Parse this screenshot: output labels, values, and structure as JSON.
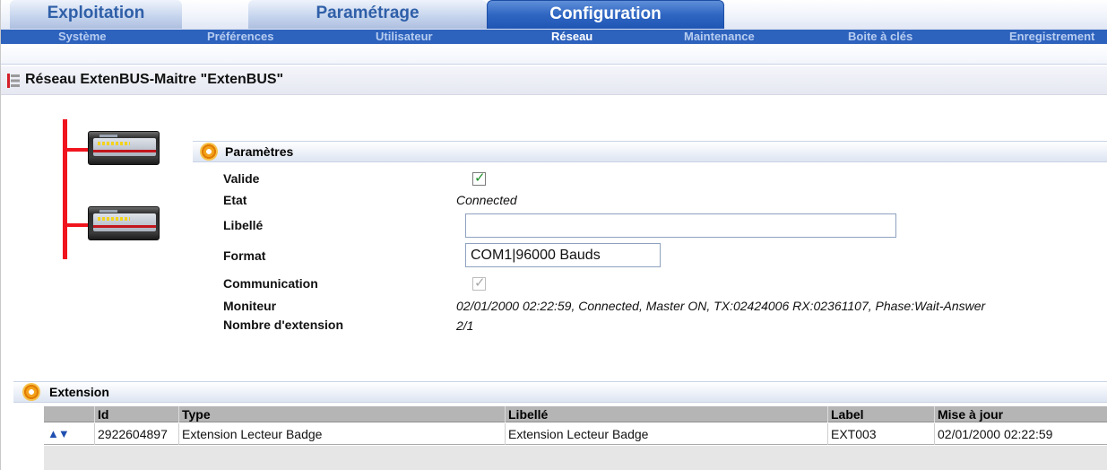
{
  "tabs": [
    {
      "label": "Exploitation",
      "active": false
    },
    {
      "label": "Paramétrage",
      "active": false
    },
    {
      "label": "Configuration",
      "active": true
    }
  ],
  "subnav": [
    {
      "label": "Système",
      "active": false
    },
    {
      "label": "Préférences",
      "active": false
    },
    {
      "label": "Utilisateur",
      "active": false
    },
    {
      "label": "Réseau",
      "active": true
    },
    {
      "label": "Maintenance",
      "active": false
    },
    {
      "label": "Boite à clés",
      "active": false
    },
    {
      "label": "Enregistrement",
      "active": false
    }
  ],
  "page": {
    "title": "Réseau ExtenBUS-Maitre \"ExtenBUS\"",
    "title_icon": "network-tree-icon"
  },
  "params": {
    "section_title": "Paramètres",
    "valide_label": "Valide",
    "valide_checked": true,
    "etat_label": "Etat",
    "etat_value": "Connected",
    "libelle_label": "Libellé",
    "libelle_value": "",
    "format_label": "Format",
    "format_value": "COM1|96000 Bauds",
    "communication_label": "Communication",
    "communication_checked": true,
    "moniteur_label": "Moniteur",
    "moniteur_value": "02/01/2000 02:22:59, Connected, Master ON,  TX:02424006 RX:02361107, Phase:Wait-Answer",
    "nb_extension_label": "Nombre d'extension",
    "nb_extension_value": "2/1"
  },
  "extension": {
    "section_title": "Extension",
    "columns": [
      "Id",
      "Type",
      "Libellé",
      "Label",
      "Mise à jour"
    ],
    "rows": [
      {
        "id": "2922604897",
        "type": "Extension Lecteur Badge",
        "libelle": "Extension Lecteur Badge",
        "label": "EXT003",
        "mise_a_jour": "02/01/2000 02:22:59"
      }
    ]
  },
  "colors": {
    "accent": "#2d62bd",
    "bus": "#f0141e",
    "ok_green": "#1f8f2a"
  }
}
